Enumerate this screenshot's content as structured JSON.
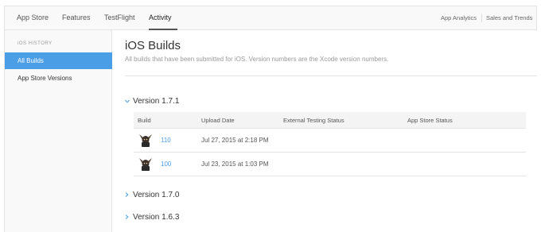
{
  "topnav": {
    "tabs": [
      "App Store",
      "Features",
      "TestFlight",
      "Activity"
    ],
    "active_tab": "Activity",
    "right_links": [
      "App Analytics",
      "Sales and Trends"
    ]
  },
  "sidebar": {
    "heading": "iOS HISTORY",
    "items": [
      {
        "label": "All Builds",
        "active": true
      },
      {
        "label": "App Store Versions",
        "active": false
      }
    ]
  },
  "main": {
    "title": "iOS Builds",
    "subtitle": "All builds that have been submitted for iOS. Version numbers are the Xcode version numbers.",
    "versions": [
      {
        "label": "Version 1.7.1",
        "expanded": true
      },
      {
        "label": "Version 1.7.0",
        "expanded": false
      },
      {
        "label": "Version 1.6.3",
        "expanded": false
      }
    ],
    "table": {
      "headers": [
        "Build",
        "Upload Date",
        "External Testing Status",
        "App Store Status"
      ],
      "rows": [
        {
          "build": "110",
          "upload_date": "Jul 27, 2015 at 2:18 PM"
        },
        {
          "build": "100",
          "upload_date": "Jul 23, 2015 at 1:03 PM"
        }
      ]
    }
  },
  "icons": {
    "expanded": "chevron-down-icon",
    "collapsed": "chevron-right-icon",
    "app": "app-icon"
  },
  "colors": {
    "accent": "#4a9ee5"
  }
}
